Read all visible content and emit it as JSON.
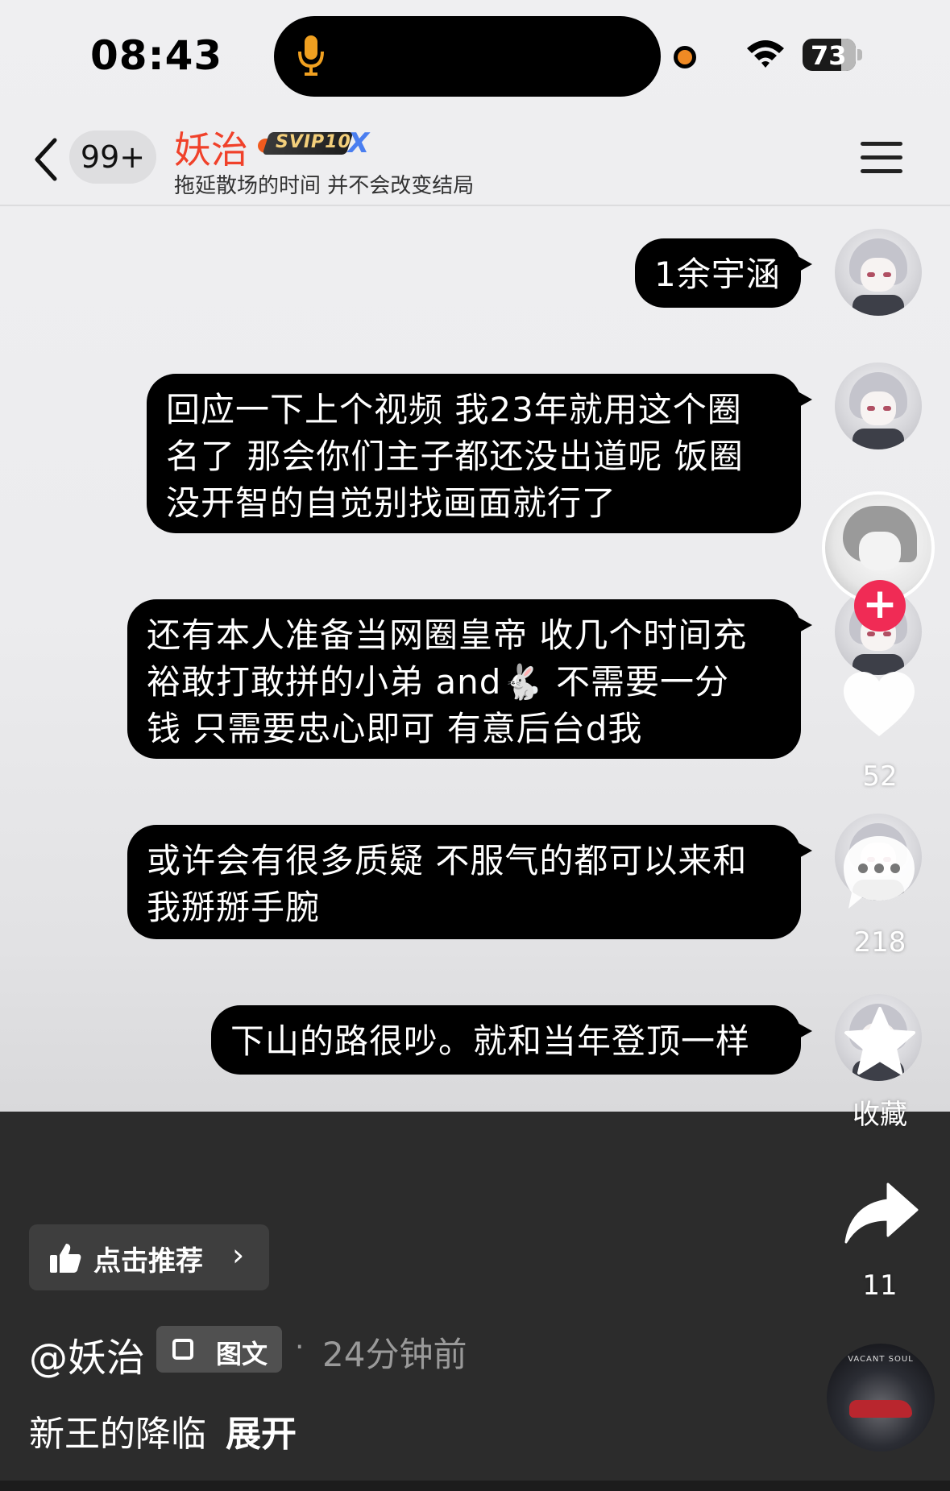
{
  "status_bar": {
    "time": "08:43",
    "battery": "73"
  },
  "header": {
    "unread_count": "99+",
    "title": "妖治",
    "vip_badge": "SVIP10",
    "vip_suffix": "X",
    "subtitle": "拖延散场的时间 并不会改变结局"
  },
  "messages": [
    {
      "text": "1余宇涵"
    },
    {
      "text": "回应一下上个视频 我23年就用这个圈\n名了 那会你们主子都还没出道呢 饭圈\n没开智的自觉别找画面就行了"
    },
    {
      "text": "还有本人准备当网圈皇帝 收几个时间充\n裕敢打敢拼的小弟 and🐇 不需要一分\n钱 只需要忠心即可 有意后台d我"
    },
    {
      "text": "或许会有很多质疑 不服气的都可以来和\n我掰掰手腕"
    },
    {
      "text": "下山的路很吵。就和当年登顶一样"
    }
  ],
  "rail": {
    "follow_symbol": "+",
    "likes": "52",
    "comments": "218",
    "favorite_label": "收藏",
    "shares": "11",
    "music_band": "VACANT SOUL"
  },
  "info": {
    "recommend_label": "点击推荐",
    "recommend_chevron": "›",
    "author": "@妖治",
    "type_label": "图文",
    "separator": "·",
    "posted": "24分钟前",
    "caption": "新王的降临",
    "expand": "展开"
  },
  "icons": [
    "microphone-icon",
    "wifi-icon",
    "back-chevron-icon",
    "menu-icon",
    "heart-icon",
    "comment-icon",
    "star-icon",
    "share-icon",
    "thumbs-up-icon",
    "image-text-icon"
  ],
  "colors": {
    "title_red": "#f0412a",
    "follow_pink": "#f02b55",
    "recording_orange": "#f08a24",
    "bubble": "#000000"
  }
}
